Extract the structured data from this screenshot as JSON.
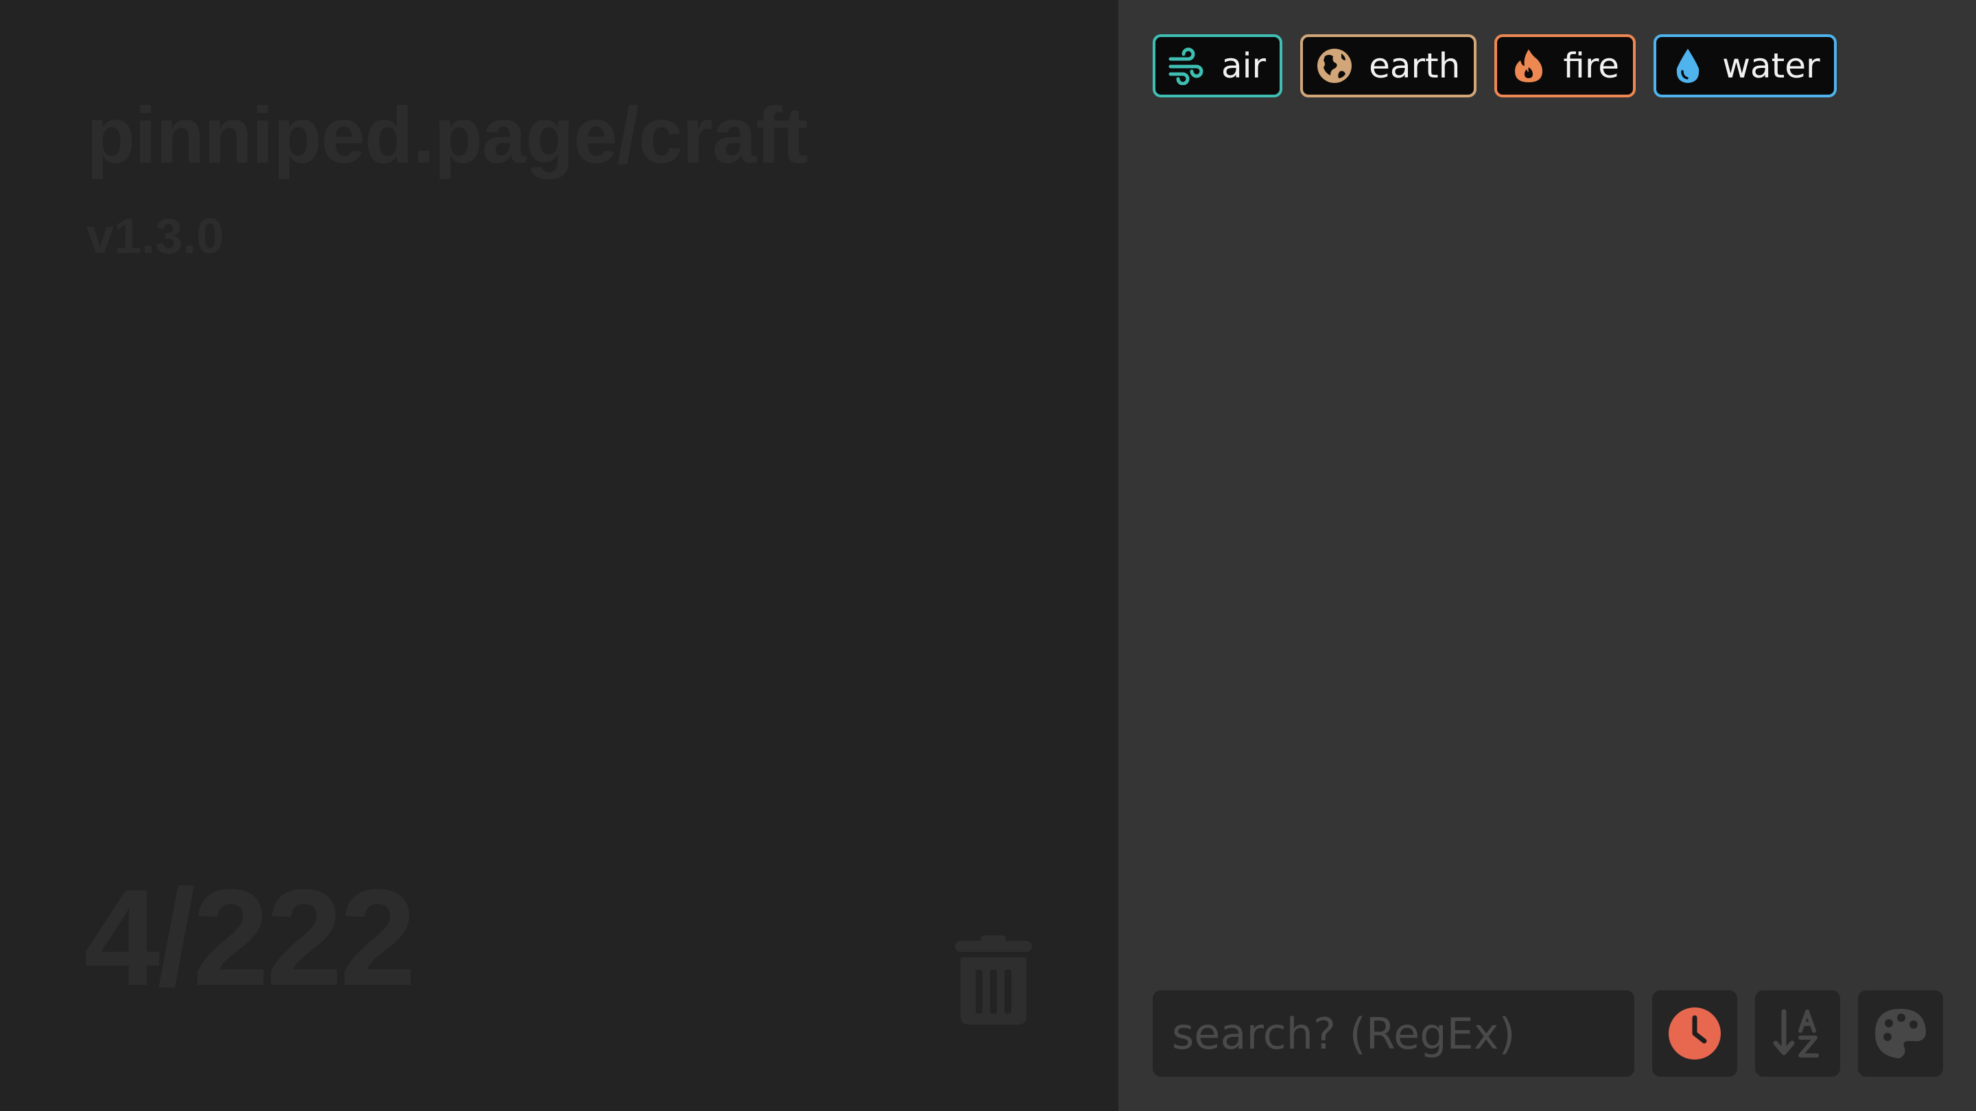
{
  "site": {
    "title": "pinniped.page/craft",
    "version": "v1.3.0",
    "counter": "4/222"
  },
  "elements": [
    {
      "label": "air",
      "icon": "wind-icon",
      "color": "#3fbfb3"
    },
    {
      "label": "earth",
      "icon": "earth-icon",
      "color": "#d2a679"
    },
    {
      "label": "fire",
      "icon": "fire-icon",
      "color": "#ee8852"
    },
    {
      "label": "water",
      "icon": "water-icon",
      "color": "#4fb3ee"
    }
  ],
  "search": {
    "placeholder": "search? (RegEx)",
    "value": ""
  },
  "toolbar": {
    "sort_time_icon": "clock-icon",
    "sort_alpha_icon": "sort-alpha-icon",
    "theme_icon": "palette-icon",
    "accent": "#e8674f"
  },
  "theme": {
    "left_bg": "#232323",
    "right_bg": "#353535",
    "watermark_text": "#2c2c2c"
  }
}
